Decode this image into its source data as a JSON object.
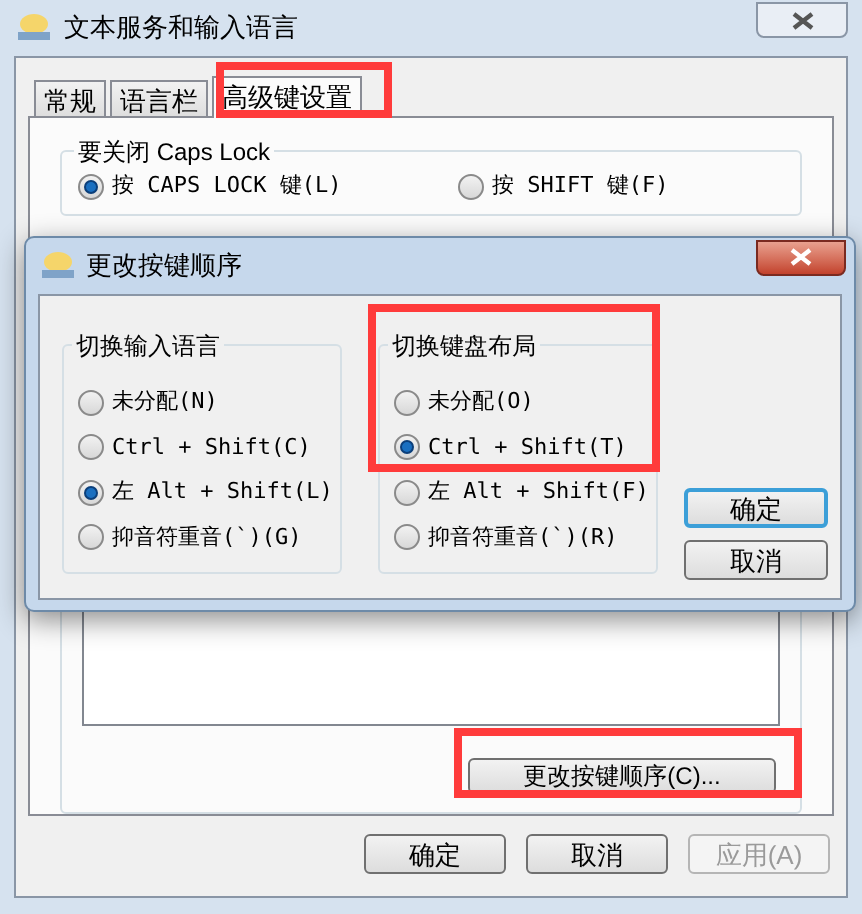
{
  "window": {
    "title": "文本服务和输入语言"
  },
  "tabs": [
    {
      "label": "常规",
      "selected": false
    },
    {
      "label": "语言栏",
      "selected": false
    },
    {
      "label": "高级键设置",
      "selected": true
    }
  ],
  "caps_lock_group": {
    "title": "要关闭 Caps Lock",
    "options": [
      {
        "label": "按 CAPS LOCK 键(L)",
        "selected": true
      },
      {
        "label": "按 SHIFT 键(F)",
        "selected": false
      }
    ]
  },
  "hotkeys_group": {
    "button": "更改按键顺序(C)..."
  },
  "buttons": [
    {
      "label": "确定",
      "disabled": false
    },
    {
      "label": "取消",
      "disabled": false
    },
    {
      "label": "应用(A)",
      "disabled": true
    }
  ],
  "dialog": {
    "title": "更改按键顺序",
    "groups": [
      {
        "title": "切换输入语言",
        "options": [
          {
            "label": "未分配(N)",
            "selected": false
          },
          {
            "label": "Ctrl + Shift(C)",
            "selected": false
          },
          {
            "label": "左 Alt + Shift(L)",
            "selected": true
          },
          {
            "label": "抑音符重音(`)(G)",
            "selected": false
          }
        ]
      },
      {
        "title": "切换键盘布局",
        "options": [
          {
            "label": "未分配(O)",
            "selected": false
          },
          {
            "label": "Ctrl + Shift(T)",
            "selected": true
          },
          {
            "label": "左 Alt + Shift(F)",
            "selected": false
          },
          {
            "label": "抑音符重音(`)(R)",
            "selected": false
          }
        ]
      }
    ],
    "buttons": [
      {
        "label": "确定",
        "default": true
      },
      {
        "label": "取消",
        "default": false
      }
    ]
  }
}
